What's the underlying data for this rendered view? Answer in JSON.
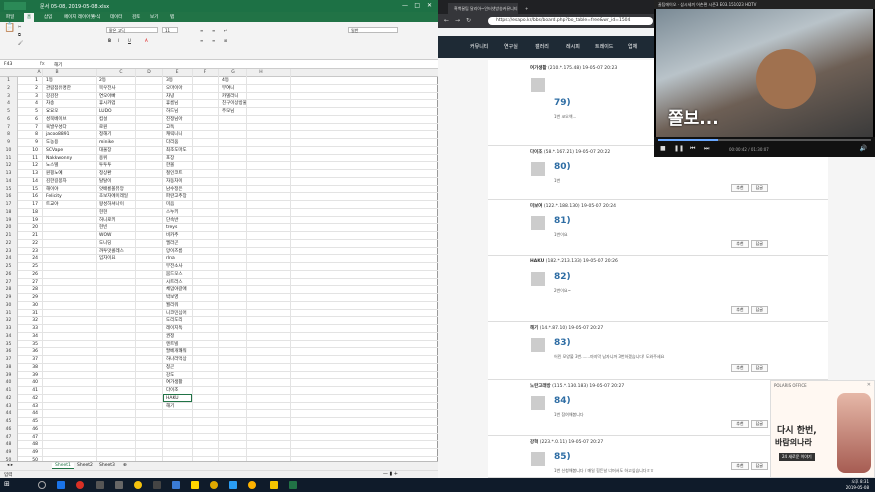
{
  "excel": {
    "title": "문서 05-08, 2019-05-08.xlsx",
    "tabs": [
      "파일",
      "홈",
      "삽입",
      "페이지 레이아웃",
      "수식",
      "데이터",
      "검토",
      "보기",
      "탭"
    ],
    "font_name": "맑은 고딕",
    "font_size": "11",
    "number_format": "일반",
    "cell_ref": "F43",
    "formula": "해기",
    "col_headers": [
      "A",
      "B",
      "C",
      "D",
      "E",
      "F",
      "G",
      "H"
    ],
    "sheets": [
      "Sheet1",
      "Sheet2",
      "Sheet3"
    ],
    "status": "입력",
    "accent": "#217346",
    "rows": [
      {
        "n": "1",
        "a": "1",
        "b": "1등",
        "c": "2등",
        "d": "",
        "f": "3등",
        "h": "4등"
      },
      {
        "n": "2",
        "a": "2",
        "b": "관람점유명한",
        "c": "목우전사",
        "d": "",
        "f": "오마이아",
        "h": "부여니"
      },
      {
        "n": "3",
        "a": "3",
        "b": "강감찬",
        "c": "연오아빠",
        "d": "",
        "f": "차녕",
        "h": "카델라니"
      },
      {
        "n": "4",
        "a": "4",
        "b": "차송",
        "c": "휴시카업",
        "d": "",
        "f": "휴름님",
        "h": "친구이상방울"
      },
      {
        "n": "5",
        "a": "5",
        "b": "요요오",
        "c": "LUDO",
        "d": "",
        "f": "하드님",
        "h": "주모님"
      },
      {
        "n": "6",
        "a": "6",
        "b": "성북베이브",
        "c": "컵설",
        "d": "",
        "f": "진정님아",
        "h": ""
      },
      {
        "n": "7",
        "a": "7",
        "b": "육발우성다",
        "c": "로원",
        "d": "",
        "f": "고독",
        "h": ""
      },
      {
        "n": "8",
        "a": "8",
        "b": "jacoo8891",
        "c": "정해기",
        "d": "",
        "f": "캐릭니니",
        "h": ""
      },
      {
        "n": "9",
        "a": "9",
        "b": "도농용",
        "c": "minike",
        "d": "",
        "f": "다리움",
        "h": ""
      },
      {
        "n": "10",
        "a": "10",
        "b": "SCVape",
        "c": "대울장",
        "d": "",
        "f": "최조도마도",
        "h": ""
      },
      {
        "n": "11",
        "a": "11",
        "b": "Nakkwonny",
        "c": "용위",
        "d": "",
        "f": "포장",
        "h": ""
      },
      {
        "n": "12",
        "a": "12",
        "b": "노스텔",
        "c": "투투투",
        "d": "",
        "f": "한볼",
        "h": ""
      },
      {
        "n": "13",
        "a": "13",
        "b": "원핑노예",
        "c": "정상환",
        "d": "",
        "f": "철인코트",
        "h": ""
      },
      {
        "n": "14",
        "a": "14",
        "b": "김한길몽자",
        "c": "탈탈이",
        "d": "",
        "f": "자동차이",
        "h": ""
      },
      {
        "n": "15",
        "a": "15",
        "b": "해이야",
        "c": "앗배룡볼뮤앙",
        "d": "",
        "f": "남수정은",
        "h": ""
      },
      {
        "n": "16",
        "a": "16",
        "b": "Felicity",
        "c": "초보자에이레일",
        "d": "",
        "f": "파란고추장",
        "h": ""
      },
      {
        "n": "17",
        "a": "17",
        "b": "트교야",
        "c": "왕성하셔나이",
        "d": "",
        "f": "미음",
        "h": ""
      },
      {
        "n": "18",
        "a": "18",
        "b": "",
        "c": "현현",
        "d": "",
        "f": "스누키",
        "h": ""
      },
      {
        "n": "19",
        "a": "19",
        "b": "",
        "c": "허니로키",
        "d": "",
        "f": "단속반",
        "h": ""
      },
      {
        "n": "20",
        "a": "20",
        "b": "",
        "c": "현빈",
        "d": "",
        "f": "treys",
        "h": ""
      },
      {
        "n": "21",
        "a": "21",
        "b": "",
        "c": "WOW",
        "d": "",
        "f": "비카추",
        "h": ""
      },
      {
        "n": "22",
        "a": "22",
        "b": "",
        "c": "도니딩",
        "d": "",
        "f": "엘라곤",
        "h": ""
      },
      {
        "n": "23",
        "a": "23",
        "b": "",
        "c": "까투맛콜레스",
        "d": "",
        "f": "망이즈름",
        "h": ""
      },
      {
        "n": "24",
        "a": "24",
        "b": "",
        "c": "임자이요",
        "d": "",
        "f": "rlna",
        "h": ""
      },
      {
        "n": "25",
        "a": "25",
        "b": "",
        "c": "",
        "d": "",
        "f": "부전소사",
        "h": ""
      },
      {
        "n": "26",
        "a": "26",
        "b": "",
        "c": "",
        "d": "",
        "f": "붐드모스",
        "h": ""
      },
      {
        "n": "27",
        "a": "27",
        "b": "",
        "c": "",
        "d": "",
        "f": "시트러스",
        "h": ""
      },
      {
        "n": "28",
        "a": "28",
        "b": "",
        "c": "",
        "d": "",
        "f": "체맘야갈애",
        "h": ""
      },
      {
        "n": "29",
        "a": "29",
        "b": "",
        "c": "",
        "d": "",
        "f": "박보영",
        "h": ""
      },
      {
        "n": "30",
        "a": "30",
        "b": "",
        "c": "",
        "d": "",
        "f": "월리워",
        "h": ""
      },
      {
        "n": "31",
        "a": "31",
        "b": "",
        "c": "",
        "d": "",
        "f": "니코민심어",
        "h": ""
      },
      {
        "n": "32",
        "a": "32",
        "b": "",
        "c": "",
        "d": "",
        "f": "도리도리",
        "h": ""
      },
      {
        "n": "33",
        "a": "33",
        "b": "",
        "c": "",
        "d": "",
        "f": "레이지독",
        "h": ""
      },
      {
        "n": "34",
        "a": "34",
        "b": "",
        "c": "",
        "d": "",
        "f": "권정",
        "h": ""
      },
      {
        "n": "35",
        "a": "35",
        "b": "",
        "c": "",
        "d": "",
        "f": "엔트빌",
        "h": ""
      },
      {
        "n": "36",
        "a": "36",
        "b": "",
        "c": "",
        "d": "",
        "f": "팔베개쾌워",
        "h": ""
      },
      {
        "n": "37",
        "a": "37",
        "b": "",
        "c": "",
        "d": "",
        "f": "하나라먹상",
        "h": ""
      },
      {
        "n": "38",
        "a": "38",
        "b": "",
        "c": "",
        "d": "",
        "f": "청곤",
        "h": ""
      },
      {
        "n": "39",
        "a": "39",
        "b": "",
        "c": "",
        "d": "",
        "f": "강도",
        "h": ""
      },
      {
        "n": "40",
        "a": "40",
        "b": "",
        "c": "",
        "d": "",
        "f": "여가생활",
        "h": ""
      },
      {
        "n": "41",
        "a": "41",
        "b": "",
        "c": "",
        "d": "",
        "f": "다이조",
        "h": ""
      },
      {
        "n": "42",
        "a": "42",
        "b": "",
        "c": "",
        "d": "",
        "f": "HAKU",
        "h": ""
      },
      {
        "n": "43",
        "a": "43",
        "b": "",
        "c": "",
        "d": "",
        "f": "해기",
        "h": ""
      },
      {
        "n": "44",
        "a": "44",
        "b": "",
        "c": "",
        "d": "",
        "f": "",
        "h": ""
      },
      {
        "n": "45",
        "a": "45",
        "b": "",
        "c": "",
        "d": "",
        "f": "",
        "h": ""
      },
      {
        "n": "46",
        "a": "46",
        "b": "",
        "c": "",
        "d": "",
        "f": "",
        "h": ""
      },
      {
        "n": "47",
        "a": "47",
        "b": "",
        "c": "",
        "d": "",
        "f": "",
        "h": ""
      },
      {
        "n": "48",
        "a": "48",
        "b": "",
        "c": "",
        "d": "",
        "f": "",
        "h": ""
      },
      {
        "n": "49",
        "a": "49",
        "b": "",
        "c": "",
        "d": "",
        "f": "",
        "h": ""
      },
      {
        "n": "50",
        "a": "50",
        "b": "",
        "c": "",
        "d": "",
        "f": "",
        "h": ""
      }
    ]
  },
  "browser": {
    "tab1": "흑백꿀팁 달리아~인터넷방송커뮤니티",
    "tab2": "+",
    "url": "https://esapo.kr/bbs/board.php?bo_table=free&wr_id=1504",
    "nav": [
      "커뮤니티",
      "연구실",
      "갤러리",
      "레시피",
      "트레이드",
      "업체"
    ],
    "comments": [
      {
        "nick": "여가생활",
        "meta": "(210.*.175.48) 19-05-07 20:23",
        "num": "79)",
        "text": "1번 코오엑..."
      },
      {
        "nick": "다이조",
        "meta": "(58.*.167.21) 19-05-07 20:22",
        "num": "80)",
        "text": "1번"
      },
      {
        "nick": "미보여",
        "meta": "(122.*.188.130) 19-05-07 20:24",
        "num": "81)",
        "text": "1번이요"
      },
      {
        "nick": "HAKU",
        "meta": "(182.*.213.133) 19-05-07 20:26",
        "num": "82)",
        "text": "2번이요~"
      },
      {
        "nick": "해기",
        "meta": "(14.*.87.10) 19-05-07 20:27",
        "num": "83)",
        "text": "어린 모양불 3번.......마지막 남자니까 3번하겠습니다! 도와주세요"
      },
      {
        "nick": "노란고래방",
        "meta": "(115.*.130.183) 19-05-07 20:27",
        "num": "84)",
        "text": "1번 참여해봅니다"
      },
      {
        "nick": "강혁",
        "meta": "(223.*.0.11) 19-05-07 20:27",
        "num": "85)",
        "text": "1번 신청해봅니다 / 매일 힘든날 너머서도 하고싶습니다ㅎㅎ"
      }
    ],
    "recommend": "추천",
    "reply": "답글"
  },
  "video": {
    "title": "꿀팁에이오 · 삼시세끼 어촌편 시즌3 E03.151023 HDTV",
    "subtitle": "쫄보...",
    "time": "00:00:42 / 01:30:07",
    "progress": 0.28
  },
  "ad": {
    "brand": "POLARIS OFFICE",
    "line1": "다시 한번,",
    "line2": "바람의나라",
    "badge": "24 새로운 이야기"
  },
  "taskbar": {
    "time": "오후 8:31",
    "date": "2019-05-08"
  }
}
